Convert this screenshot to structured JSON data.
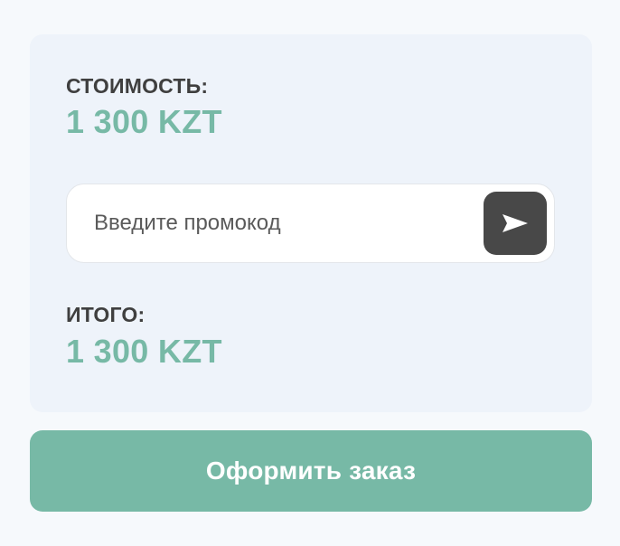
{
  "summary": {
    "cost_label": "СТОИМОСТЬ:",
    "cost_value": "1 300 KZT",
    "total_label": "ИТОГО:",
    "total_value": "1 300 KZT"
  },
  "promo": {
    "placeholder": "Введите промокод",
    "value": "",
    "send_icon": "send-arrow-icon"
  },
  "actions": {
    "checkout_label": "Оформить заказ"
  },
  "colors": {
    "accent": "#77b9a6",
    "card_bg": "#eef3fa",
    "page_bg": "#f6f9fc",
    "dark_button": "#484848",
    "label_text": "#3f3f3f"
  }
}
